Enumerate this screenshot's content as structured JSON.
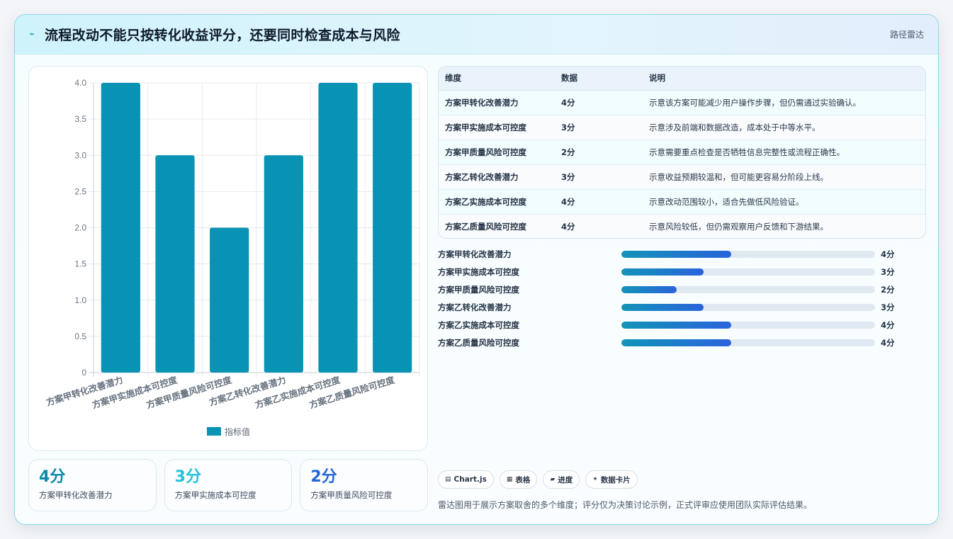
{
  "header": {
    "icon": "trend-icon",
    "title": "流程改动不能只按转化收益评分，还要同时检查成本与风险",
    "tag": "路径雷达"
  },
  "chart_data": {
    "type": "bar",
    "categories": [
      "方案甲转化改善潜力",
      "方案甲实施成本可控度",
      "方案甲质量风险可控度",
      "方案乙转化改善潜力",
      "方案乙实施成本可控度",
      "方案乙质量风险可控度"
    ],
    "series": [
      {
        "name": "指标值",
        "values": [
          4,
          3,
          2,
          3,
          4,
          4
        ]
      }
    ],
    "ylim": [
      0,
      4
    ],
    "yticks": [
      "0",
      "0.5",
      "1.0",
      "1.5",
      "2.0",
      "2.5",
      "3.0",
      "3.5",
      "4.0"
    ],
    "grid": true,
    "legend": "bottom",
    "color": "#0892b3"
  },
  "stats": [
    {
      "value": "4分",
      "label": "方案甲转化改善潜力",
      "color": "#0b89a9"
    },
    {
      "value": "3分",
      "label": "方案甲实施成本可控度",
      "color": "#22c1dc"
    },
    {
      "value": "2分",
      "label": "方案甲质量风险可控度",
      "color": "#2366d6"
    }
  ],
  "table": {
    "headers": [
      "维度",
      "数据",
      "说明"
    ],
    "rows": [
      {
        "dim": "方案甲转化改善潜力",
        "val": "4分",
        "note": "示意该方案可能减少用户操作步骤，但仍需通过实验确认。"
      },
      {
        "dim": "方案甲实施成本可控度",
        "val": "3分",
        "note": "示意涉及前端和数据改造，成本处于中等水平。"
      },
      {
        "dim": "方案甲质量风险可控度",
        "val": "2分",
        "note": "示意需要重点检查是否牺牲信息完整性或流程正确性。"
      },
      {
        "dim": "方案乙转化改善潜力",
        "val": "3分",
        "note": "示意收益预期较温和，但可能更容易分阶段上线。"
      },
      {
        "dim": "方案乙实施成本可控度",
        "val": "4分",
        "note": "示意改动范围较小，适合先做低风险验证。"
      },
      {
        "dim": "方案乙质量风险可控度",
        "val": "4分",
        "note": "示意风险较低，但仍需观察用户反馈和下游结果。"
      }
    ]
  },
  "progress": [
    {
      "label": "方案甲转化改善潜力",
      "value": "4分",
      "fraction": 0.4333
    },
    {
      "label": "方案甲实施成本可控度",
      "value": "3分",
      "fraction": 0.325
    },
    {
      "label": "方案甲质量风险可控度",
      "value": "2分",
      "fraction": 0.2167
    },
    {
      "label": "方案乙转化改善潜力",
      "value": "3分",
      "fraction": 0.325
    },
    {
      "label": "方案乙实施成本可控度",
      "value": "4分",
      "fraction": 0.4333
    },
    {
      "label": "方案乙质量风险可控度",
      "value": "4分",
      "fraction": 0.4333
    }
  ],
  "chips": [
    {
      "icon": "chart-icon",
      "label": "Chart.js"
    },
    {
      "icon": "table-icon",
      "label": "表格"
    },
    {
      "icon": "progress-icon",
      "label": "进度"
    },
    {
      "icon": "card-icon",
      "label": "数据卡片"
    }
  ],
  "footnote": "雷达图用于展示方案取舍的多个维度；评分仅为决策讨论示例，正式评审应使用团队实际评估结果。"
}
